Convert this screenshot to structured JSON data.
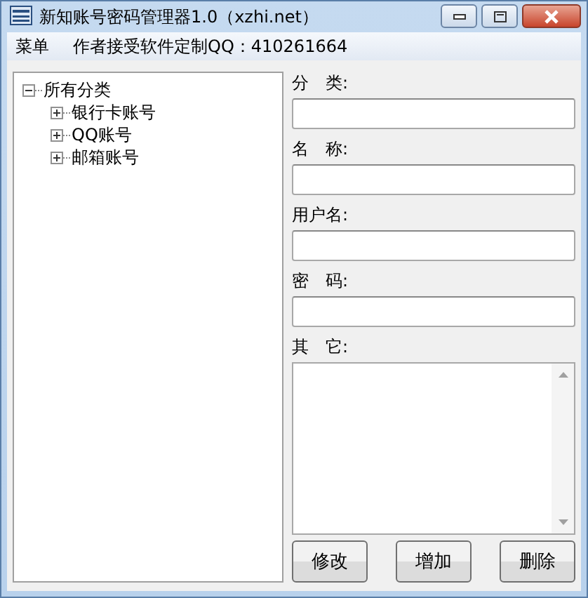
{
  "window": {
    "title": "新知账号密码管理器1.0（xzhi.net）"
  },
  "menu_bar": [
    "菜单",
    "作者接受软件定制QQ：410261664"
  ],
  "tree": [
    {
      "label": "所有分类",
      "expanded": true,
      "children": [
        {
          "label": "银行卡账号",
          "expanded": false
        },
        {
          "label": "QQ账号",
          "expanded": false
        },
        {
          "label": "邮箱账号",
          "expanded": false
        }
      ]
    }
  ],
  "fields": [
    {
      "label": "分　类:",
      "kind": "line"
    },
    {
      "label": "名　称:",
      "kind": "line"
    },
    {
      "label": "用户名:",
      "kind": "line"
    },
    {
      "label": "密　码:",
      "kind": "line"
    },
    {
      "label": "其　它:",
      "kind": "area"
    }
  ],
  "buttons": [
    "修改",
    "增加",
    "删除"
  ]
}
